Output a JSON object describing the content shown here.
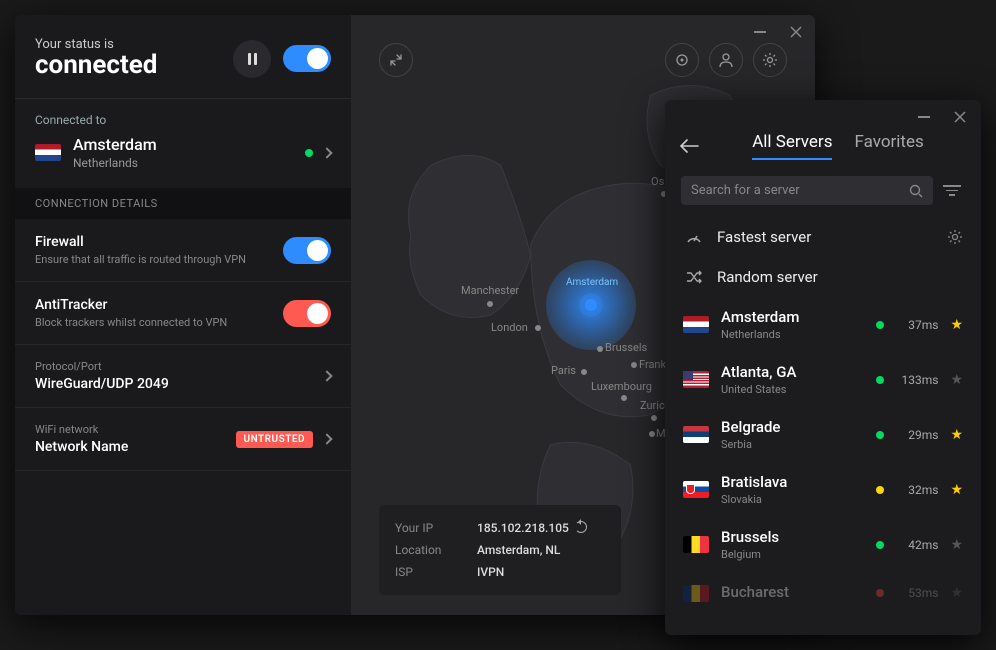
{
  "status": {
    "prefix": "Your status is",
    "value": "connected"
  },
  "connected": {
    "label": "Connected to",
    "city": "Amsterdam",
    "country": "Netherlands"
  },
  "section_header": "CONNECTION DETAILS",
  "firewall": {
    "title": "Firewall",
    "subtitle": "Ensure that all traffic is routed through VPN"
  },
  "antitracker": {
    "title": "AntiTracker",
    "subtitle": "Block trackers whilst connected to VPN"
  },
  "protocol": {
    "label": "Protocol/Port",
    "value": "WireGuard/UDP 2049"
  },
  "wifi": {
    "label": "WiFi network",
    "value": "Network Name",
    "badge": "UNTRUSTED"
  },
  "ipbox": {
    "ip_label": "Your IP",
    "ip": "185.102.218.105",
    "loc_label": "Location",
    "loc": "Amsterdam, NL",
    "isp_label": "ISP",
    "isp": "IVPN"
  },
  "map_cities": {
    "oslo": "Osl",
    "manchester": "Manchester",
    "london": "London",
    "amsterdam": "Amsterdam",
    "brussels": "Brussels",
    "paris": "Paris",
    "frankfurt": "Frankf",
    "luxembourg": "Luxembourg",
    "zurich": "Zurich",
    "milan": "Milan"
  },
  "server_panel": {
    "tabs": {
      "all": "All Servers",
      "fav": "Favorites"
    },
    "search_placeholder": "Search for a server",
    "fastest": "Fastest server",
    "random": "Random server",
    "servers": [
      {
        "city": "Amsterdam",
        "country": "Netherlands",
        "ping": "37ms",
        "fav": true,
        "status": "green",
        "flag": "nl"
      },
      {
        "city": "Atlanta, GA",
        "country": "United States",
        "ping": "133ms",
        "fav": false,
        "status": "green",
        "flag": "us"
      },
      {
        "city": "Belgrade",
        "country": "Serbia",
        "ping": "29ms",
        "fav": true,
        "status": "green",
        "flag": "rs"
      },
      {
        "city": "Bratislava",
        "country": "Slovakia",
        "ping": "32ms",
        "fav": true,
        "status": "yellow",
        "flag": "sk"
      },
      {
        "city": "Brussels",
        "country": "Belgium",
        "ping": "42ms",
        "fav": false,
        "status": "green",
        "flag": "be"
      },
      {
        "city": "Bucharest",
        "country": "",
        "ping": "53ms",
        "fav": false,
        "status": "red",
        "flag": "ro",
        "faded": true
      }
    ]
  }
}
